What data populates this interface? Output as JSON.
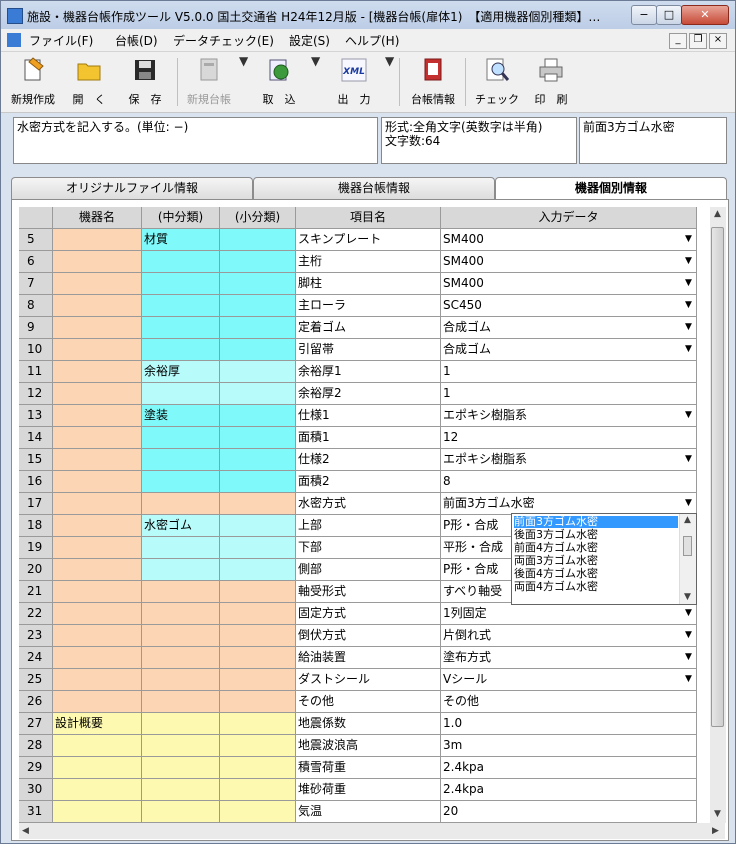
{
  "window": {
    "title": "施設・機器台帳作成ツール V5.0.0 国土交通省 H24年12月版 - [機器台帳(扉体1)　【適用機器個別種類】…",
    "min_label": "−",
    "max_label": "□",
    "close_label": "✕"
  },
  "menu": {
    "items": [
      "ファイル(F)",
      "台帳(D)",
      "データチェック(E)",
      "設定(S)",
      "ヘルプ(H)"
    ],
    "mdi_min": "_",
    "mdi_restore": "❐",
    "mdi_close": "×"
  },
  "toolbar": {
    "new": "新規作成",
    "open": "開　く",
    "save": "保　存",
    "new_ledger": "新規台帳",
    "import": "取　込",
    "output": "出　力",
    "ledger_info": "台帳情報",
    "check": "チェック",
    "print": "印　刷",
    "xml_text": "XML",
    "drop_arrow": "▼"
  },
  "info": {
    "description": "水密方式を記入する。(単位: −)",
    "format_line1": "形式:全角文字(英数字は半角)",
    "format_line2": "文字数:64",
    "current_value": "前面3方ゴム水密"
  },
  "tabs": [
    "オリジナルファイル情報",
    "機器台帳情報",
    "機器個別情報"
  ],
  "grid": {
    "headers": [
      "機器名",
      "(中分類)",
      "(小分類)",
      "項目名",
      "入力データ"
    ],
    "rows": [
      {
        "n": "5",
        "name": "",
        "mid": "材質",
        "sm": "",
        "item": "スキンプレート",
        "val": "SM400",
        "dd": true,
        "c": [
          "peach",
          "aqua",
          "aqua"
        ]
      },
      {
        "n": "6",
        "name": "",
        "mid": "",
        "sm": "",
        "item": "主桁",
        "val": "SM400",
        "dd": true,
        "c": [
          "peach",
          "aqua",
          "aqua"
        ]
      },
      {
        "n": "7",
        "name": "",
        "mid": "",
        "sm": "",
        "item": "脚柱",
        "val": "SM400",
        "dd": true,
        "c": [
          "peach",
          "aqua",
          "aqua"
        ]
      },
      {
        "n": "8",
        "name": "",
        "mid": "",
        "sm": "",
        "item": "主ローラ",
        "val": "SC450",
        "dd": true,
        "c": [
          "peach",
          "aqua",
          "aqua"
        ]
      },
      {
        "n": "9",
        "name": "",
        "mid": "",
        "sm": "",
        "item": "定着ゴム",
        "val": "合成ゴム",
        "dd": true,
        "c": [
          "peach",
          "aqua",
          "aqua"
        ]
      },
      {
        "n": "10",
        "name": "",
        "mid": "",
        "sm": "",
        "item": "引留帯",
        "val": "合成ゴム",
        "dd": true,
        "c": [
          "peach",
          "aqua",
          "aqua"
        ]
      },
      {
        "n": "11",
        "name": "",
        "mid": "余裕厚",
        "sm": "",
        "item": "余裕厚1",
        "val": "1",
        "dd": false,
        "c": [
          "peach",
          "laqua",
          "laqua"
        ]
      },
      {
        "n": "12",
        "name": "",
        "mid": "",
        "sm": "",
        "item": "余裕厚2",
        "val": "1",
        "dd": false,
        "c": [
          "peach",
          "laqua",
          "laqua"
        ]
      },
      {
        "n": "13",
        "name": "",
        "mid": "塗装",
        "sm": "",
        "item": "仕様1",
        "val": "エポキシ樹脂系",
        "dd": true,
        "c": [
          "peach",
          "aqua",
          "aqua"
        ]
      },
      {
        "n": "14",
        "name": "",
        "mid": "",
        "sm": "",
        "item": "面積1",
        "val": "12",
        "dd": false,
        "c": [
          "peach",
          "aqua",
          "aqua"
        ]
      },
      {
        "n": "15",
        "name": "",
        "mid": "",
        "sm": "",
        "item": "仕様2",
        "val": "エポキシ樹脂系",
        "dd": true,
        "c": [
          "peach",
          "aqua",
          "aqua"
        ]
      },
      {
        "n": "16",
        "name": "",
        "mid": "",
        "sm": "",
        "item": "面積2",
        "val": "8",
        "dd": false,
        "c": [
          "peach",
          "aqua",
          "aqua"
        ]
      },
      {
        "n": "17",
        "name": "",
        "mid": "",
        "sm": "",
        "item": "水密方式",
        "val": "前面3方ゴム水密",
        "dd": true,
        "c": [
          "peach",
          "peach",
          "peach"
        ]
      },
      {
        "n": "18",
        "name": "",
        "mid": "水密ゴム",
        "sm": "",
        "item": "上部",
        "val": "P形・合成",
        "dd": false,
        "c": [
          "peach",
          "laqua",
          "laqua"
        ]
      },
      {
        "n": "19",
        "name": "",
        "mid": "",
        "sm": "",
        "item": "下部",
        "val": "平形・合成",
        "dd": false,
        "c": [
          "peach",
          "laqua",
          "laqua"
        ]
      },
      {
        "n": "20",
        "name": "",
        "mid": "",
        "sm": "",
        "item": "側部",
        "val": "P形・合成",
        "dd": false,
        "c": [
          "peach",
          "laqua",
          "laqua"
        ]
      },
      {
        "n": "21",
        "name": "",
        "mid": "",
        "sm": "",
        "item": "軸受形式",
        "val": "すべり軸受",
        "dd": false,
        "c": [
          "peach",
          "peach",
          "peach"
        ]
      },
      {
        "n": "22",
        "name": "",
        "mid": "",
        "sm": "",
        "item": "固定方式",
        "val": "1列固定",
        "dd": true,
        "c": [
          "peach",
          "peach",
          "peach"
        ]
      },
      {
        "n": "23",
        "name": "",
        "mid": "",
        "sm": "",
        "item": "倒伏方式",
        "val": "片倒れ式",
        "dd": true,
        "c": [
          "peach",
          "peach",
          "peach"
        ]
      },
      {
        "n": "24",
        "name": "",
        "mid": "",
        "sm": "",
        "item": "給油装置",
        "val": "塗布方式",
        "dd": true,
        "c": [
          "peach",
          "peach",
          "peach"
        ]
      },
      {
        "n": "25",
        "name": "",
        "mid": "",
        "sm": "",
        "item": "ダストシール",
        "val": "Vシール",
        "dd": true,
        "c": [
          "peach",
          "peach",
          "peach"
        ]
      },
      {
        "n": "26",
        "name": "",
        "mid": "",
        "sm": "",
        "item": "その他",
        "val": "その他",
        "dd": false,
        "c": [
          "peach",
          "peach",
          "peach"
        ]
      },
      {
        "n": "27",
        "name": "設計概要",
        "mid": "",
        "sm": "",
        "item": "地震係数",
        "val": "1.0",
        "dd": false,
        "c": [
          "lyel",
          "lyel",
          "lyel"
        ]
      },
      {
        "n": "28",
        "name": "",
        "mid": "",
        "sm": "",
        "item": "地震波浪高",
        "val": "3m",
        "dd": false,
        "c": [
          "lyel",
          "lyel",
          "lyel"
        ]
      },
      {
        "n": "29",
        "name": "",
        "mid": "",
        "sm": "",
        "item": "積雪荷重",
        "val": "2.4kpa",
        "dd": false,
        "c": [
          "lyel",
          "lyel",
          "lyel"
        ]
      },
      {
        "n": "30",
        "name": "",
        "mid": "",
        "sm": "",
        "item": "堆砂荷重",
        "val": "2.4kpa",
        "dd": false,
        "c": [
          "lyel",
          "lyel",
          "lyel"
        ]
      },
      {
        "n": "31",
        "name": "",
        "mid": "",
        "sm": "",
        "item": "気温",
        "val": "20",
        "dd": false,
        "c": [
          "lyel",
          "lyel",
          "lyel"
        ]
      }
    ]
  },
  "dropdown_list": [
    "前面3方ゴム水密",
    "後面3方ゴム水密",
    "前面4方ゴム水密",
    "両面3方ゴム水密",
    "後面4方ゴム水密",
    "両面4方ゴム水密"
  ],
  "colors": {
    "peach": "#fcd5b5",
    "aqua": "#7ff9f9",
    "light_aqua": "#b7fbfb",
    "light_yellow": "#fef9b0",
    "selection": "#3399ff"
  }
}
